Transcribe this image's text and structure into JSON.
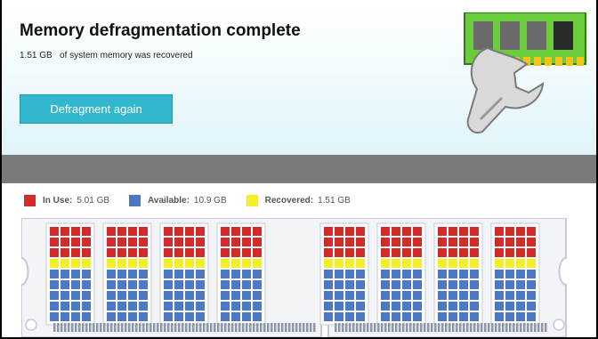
{
  "header": {
    "title": "Memory defragmentation complete",
    "recovered_amount": "1.51 GB",
    "recovered_text": "of system memory was recovered",
    "button_label": "Defragment again"
  },
  "legend": [
    {
      "label": "In Use:",
      "value": "5.01 GB",
      "color": "#d42a2a"
    },
    {
      "label": "Available:",
      "value": "10.9 GB",
      "color": "#4a78c4"
    },
    {
      "label": "Recovered:",
      "value": "1.51 GB",
      "color": "#f5ee22"
    }
  ],
  "colors": {
    "accent": "#31b8cf",
    "in_use": "#d42a2a",
    "available": "#4a78c4",
    "recovered": "#f5ee22",
    "stick_bg": "#f3f4f7",
    "stick_border": "#c5cad6"
  },
  "memory_chips": {
    "count": 8,
    "rows_in_use": 3,
    "rows_recovered": 1,
    "rows_available": 5,
    "columns": 4
  },
  "icons": {
    "ram_tool": "ram-wrench-icon"
  }
}
